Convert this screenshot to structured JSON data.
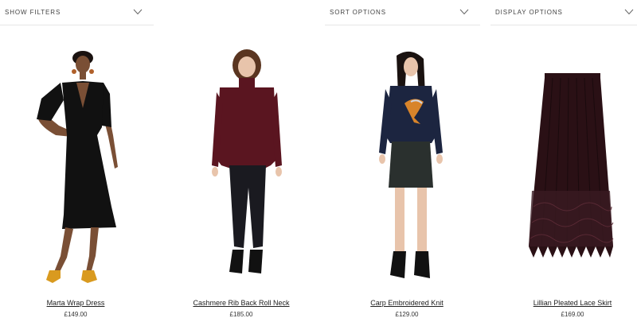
{
  "toolbar": {
    "filters_label": "SHOW FILTERS",
    "sort_label": "SORT OPTIONS",
    "display_label": "DISPLAY OPTIONS"
  },
  "products": [
    {
      "name": "Marta Wrap Dress",
      "price": "£149.00",
      "image": "black-wrap-dress-photo"
    },
    {
      "name": "Cashmere Rib Back Roll Neck",
      "price": "£185.00",
      "image": "burgundy-roll-neck-photo"
    },
    {
      "name": "Carp Embroidered Knit",
      "price": "£129.00",
      "image": "navy-embroidered-knit-photo"
    },
    {
      "name": "Lillian Pleated Lace Skirt",
      "price": "£169.00",
      "image": "burgundy-lace-skirt-photo"
    }
  ],
  "colors": {
    "text": "#222222",
    "divider": "#e6e6e6",
    "dress": "#111111",
    "burgundy": "#5a1520",
    "navy": "#1c2540",
    "skirt": "#2a1015",
    "shoe_mustard": "#d99a1f"
  }
}
